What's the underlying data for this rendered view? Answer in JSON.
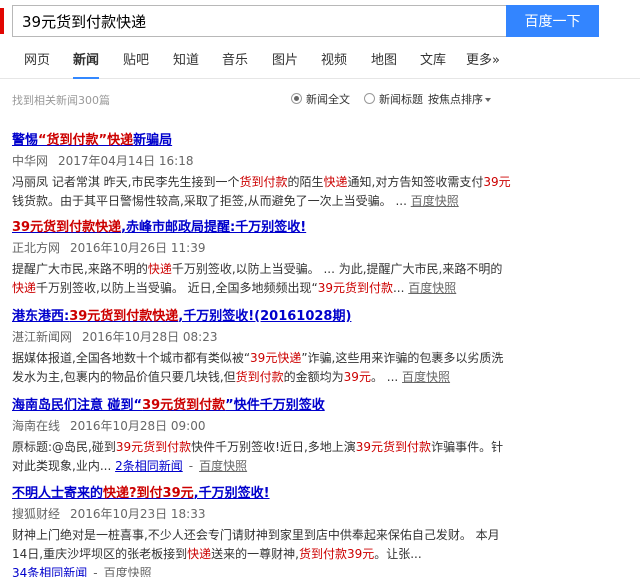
{
  "search": {
    "query": "39元货到付款快递",
    "button": "百度一下"
  },
  "tabs": [
    "网页",
    "新闻",
    "贴吧",
    "知道",
    "音乐",
    "图片",
    "视频",
    "地图",
    "文库",
    "更多»"
  ],
  "meta": {
    "count": "找到相关新闻300篇",
    "full": "新闻全文",
    "title": "新闻标题",
    "sort": "按焦点排序"
  },
  "results": [
    {
      "title": {
        "p1": "警惕",
        "h1": "“货到付款”快递",
        "p2": "新骗局"
      },
      "source": "中华网",
      "time": "2017年04月14日 16:18",
      "abs": {
        "a1": "冯丽凤 记者常淇 昨天,市民李先生接到一个",
        "h1": "货到付款",
        "a2": "的陌生",
        "h2": "快递",
        "a3": "通知,对方告知签收需支付",
        "h3": "39元",
        "a4": "钱货款。由于其平日警惕性较高,采取了拒签,从而避免了一次上当受骗。 ... "
      },
      "cache": "百度快照"
    },
    {
      "title": {
        "h1": "39元货到付款快递",
        "p1": ",赤峰市邮政局提醒:千万别签收!"
      },
      "source": "正北方网",
      "time": "2016年10月26日 11:39",
      "abs": {
        "a1": "提醒广大市民,来路不明的",
        "h1": "快递",
        "a2": "千万别签收,以防上当受骗。 ... 为此,提醒广大市民,来路不明的",
        "h2": "快递",
        "a3": "千万别签收,以防上当受骗。 近日,全国多地频频出现“",
        "h3": "39元货到付款",
        "a4": "... "
      },
      "cache": "百度快照"
    },
    {
      "title": {
        "p1": "港东港西:",
        "h1": "39元货到付款快递",
        "p2": ",千万别签收!(20161028期)"
      },
      "source": "湛江新闻网",
      "time": "2016年10月28日 08:23",
      "abs": {
        "a1": "据媒体报道,全国各地数十个城市都有类似被“",
        "h1": "39元快递",
        "a2": "”诈骗,这些用来诈骗的包裹多以劣质洗发水为主,包裹内的物品价值只要几块钱,但",
        "h2": "货到付款",
        "a3": "的金额均为",
        "h3": "39元",
        "a4": "。 ... "
      },
      "cache": "百度快照"
    },
    {
      "title": {
        "p1": "海南岛民们注意 碰到“",
        "h1": "39元货到付款",
        "p2": "”快件千万别签收"
      },
      "source": "海南在线",
      "time": "2016年10月28日 09:00",
      "abs": {
        "a1": "原标题:@岛民,碰到",
        "h1": "39元货到付款",
        "a2": "快件千万别签收!近日,多地上演",
        "h2": "39元货到付款",
        "a3": "诈骗事件。针对此类现象,业内... ",
        "h3": "",
        "a4": ""
      },
      "same": "2条相同新闻",
      "cache": "百度快照"
    },
    {
      "title": {
        "p1": "不明人士寄来的",
        "h1": "快递?到付39元",
        "p2": ",千万别签收!"
      },
      "source": "搜狐财经",
      "time": "2016年10月23日 18:33",
      "abs": {
        "a1": "财神上门绝对是一桩喜事,不少人还会专门请财神到家里到店中供奉起来保佑自己发财。 本月14日,重庆沙坪坝区的张老板接到",
        "h1": "快递",
        "a2": "送来的一尊财神,",
        "h2": "货到付款39元",
        "a3": "。让张...",
        "h3": "",
        "a4": ""
      },
      "same": "34条相同新闻",
      "cache": "百度快照"
    }
  ]
}
